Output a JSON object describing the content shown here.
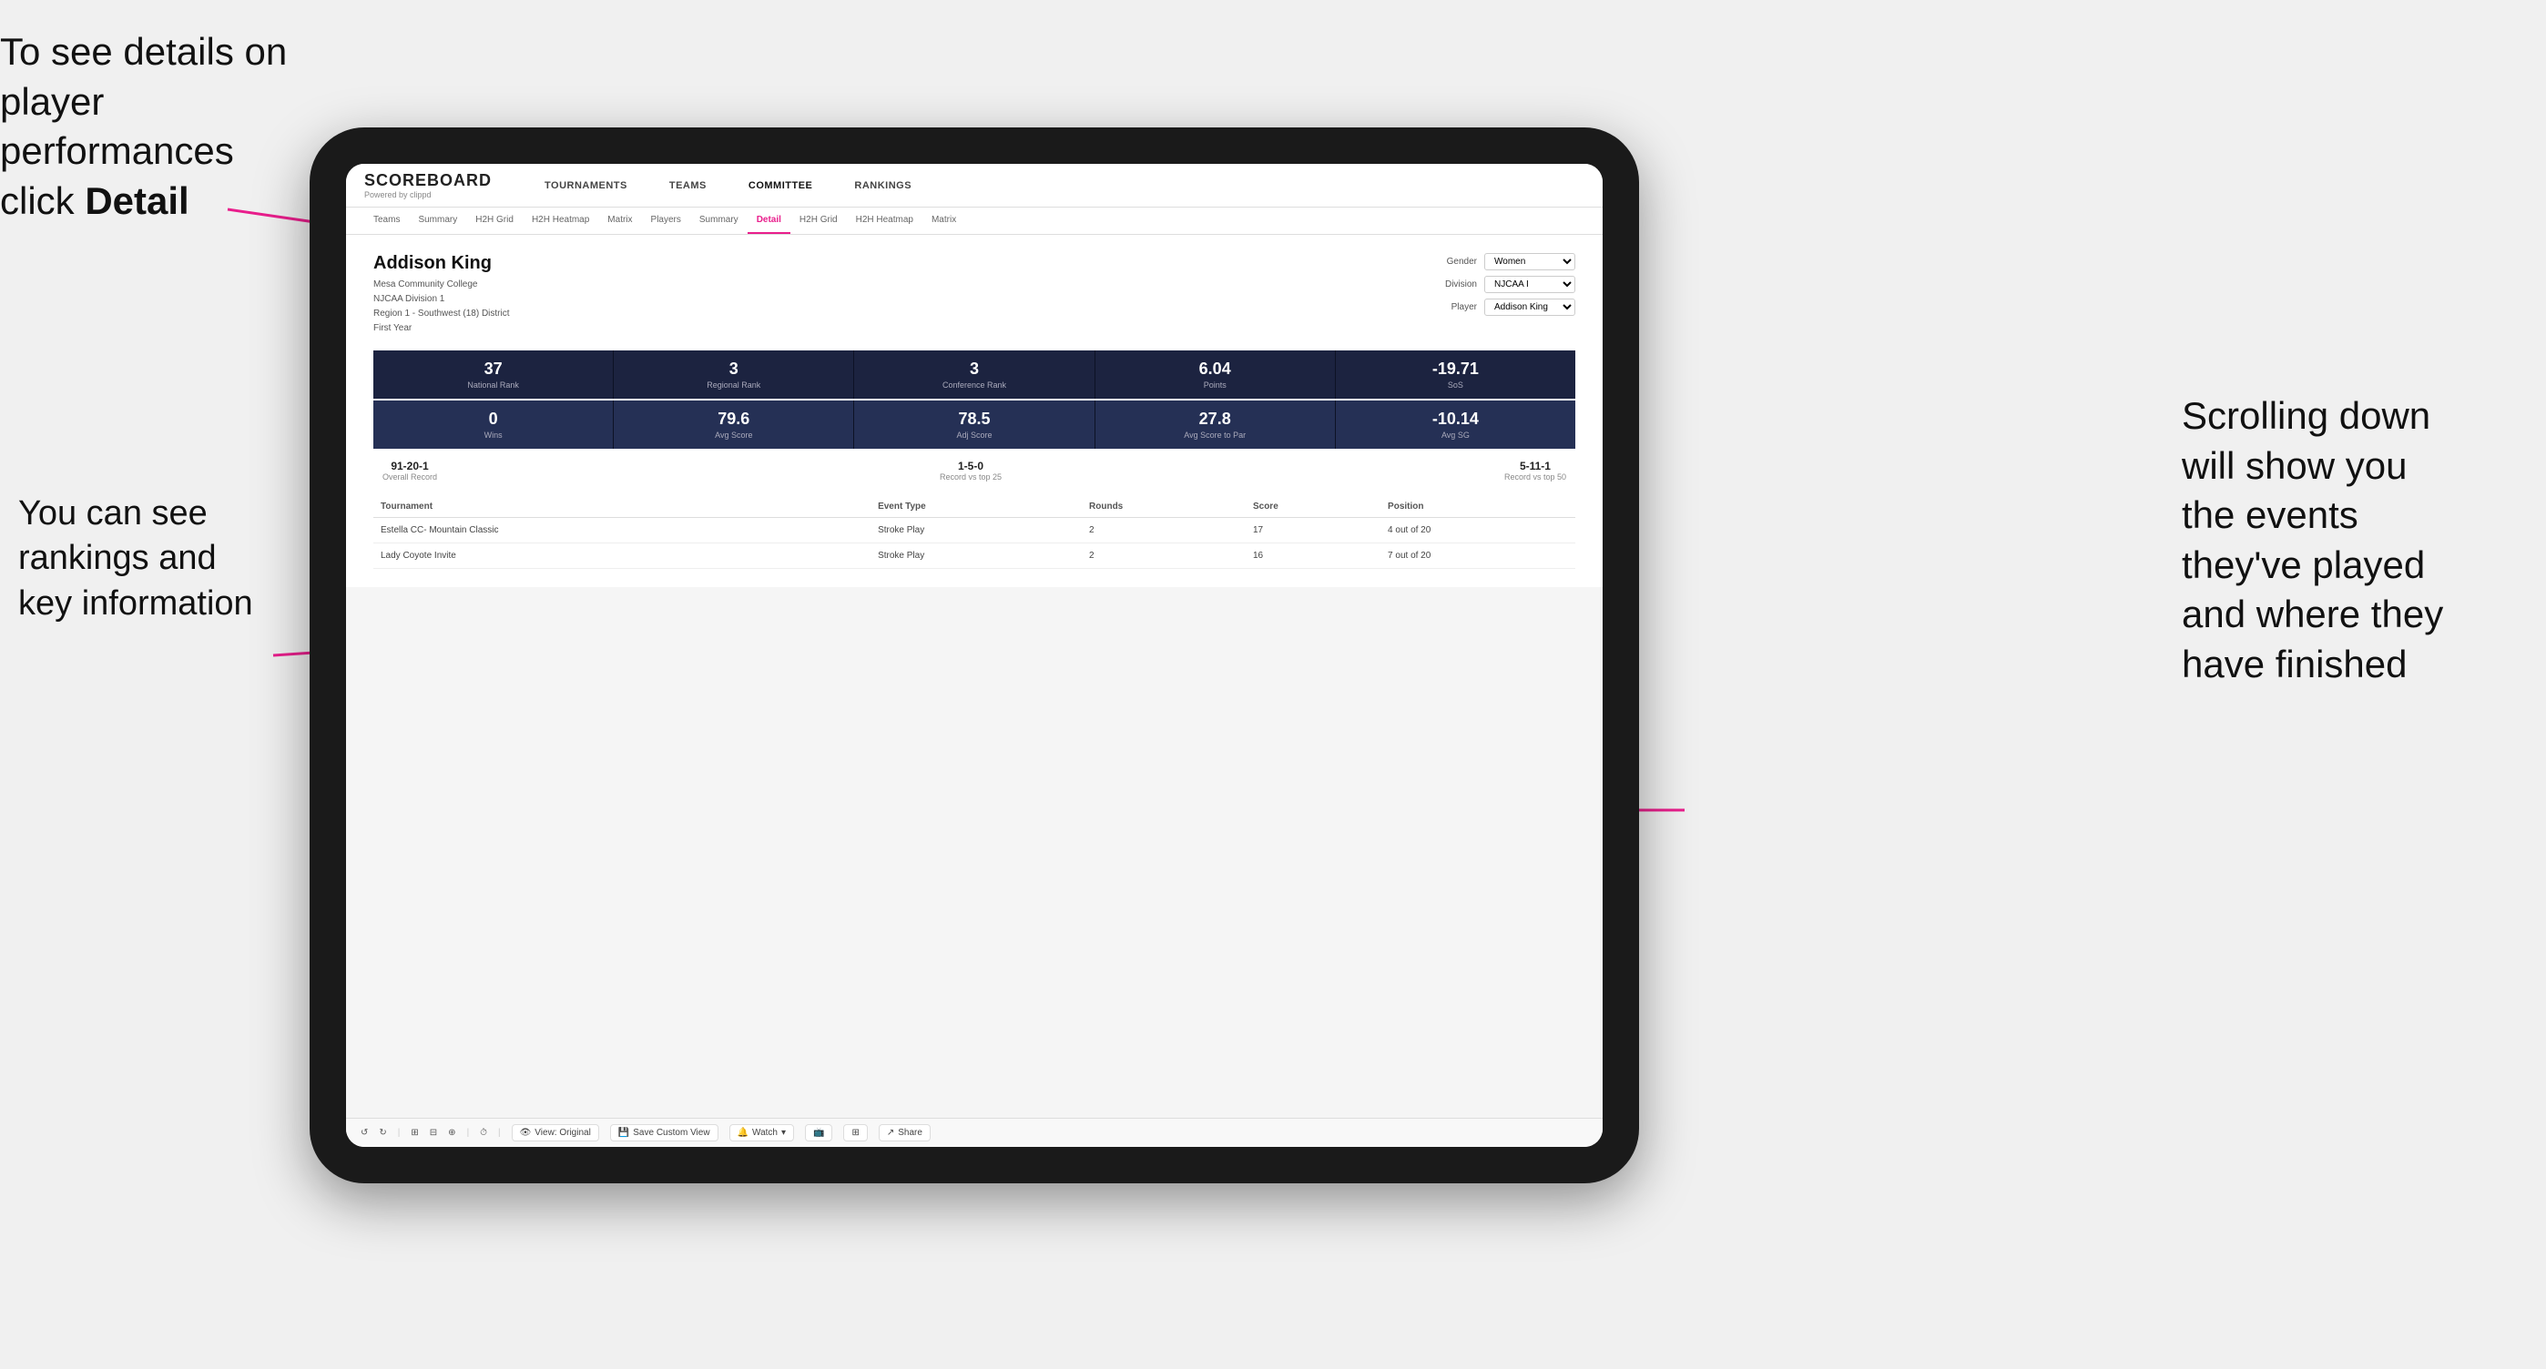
{
  "annotations": {
    "top_left_line1": "To see details on",
    "top_left_line2": "player performances",
    "top_left_line3": "click ",
    "top_left_bold": "Detail",
    "bottom_left_line1": "You can see",
    "bottom_left_line2": "rankings and",
    "bottom_left_line3": "key information",
    "right_line1": "Scrolling down",
    "right_line2": "will show you",
    "right_line3": "the events",
    "right_line4": "they've played",
    "right_line5": "and where they",
    "right_line6": "have finished"
  },
  "nav": {
    "logo": "SCOREBOARD",
    "logo_sub": "Powered by clippd",
    "items": [
      "TOURNAMENTS",
      "TEAMS",
      "COMMITTEE",
      "RANKINGS"
    ]
  },
  "sub_tabs": [
    "Teams",
    "Summary",
    "H2H Grid",
    "H2H Heatmap",
    "Matrix",
    "Players",
    "Summary",
    "Detail",
    "H2H Grid",
    "H2H Heatmap",
    "Matrix"
  ],
  "active_tab": "Detail",
  "player": {
    "name": "Addison King",
    "school": "Mesa Community College",
    "division": "NJCAA Division 1",
    "region": "Region 1 - Southwest (18) District",
    "year": "First Year",
    "gender_label": "Gender",
    "gender_value": "Women",
    "division_label": "Division",
    "division_value": "NJCAA I",
    "player_label": "Player",
    "player_value": "Addison King"
  },
  "stats_row1": [
    {
      "value": "37",
      "label": "National Rank"
    },
    {
      "value": "3",
      "label": "Regional Rank"
    },
    {
      "value": "3",
      "label": "Conference Rank"
    },
    {
      "value": "6.04",
      "label": "Points"
    },
    {
      "value": "-19.71",
      "label": "SoS"
    }
  ],
  "stats_row2": [
    {
      "value": "0",
      "label": "Wins"
    },
    {
      "value": "79.6",
      "label": "Avg Score"
    },
    {
      "value": "78.5",
      "label": "Adj Score"
    },
    {
      "value": "27.8",
      "label": "Avg Score to Par"
    },
    {
      "value": "-10.14",
      "label": "Avg SG"
    }
  ],
  "records": [
    {
      "value": "91-20-1",
      "label": "Overall Record"
    },
    {
      "value": "1-5-0",
      "label": "Record vs top 25"
    },
    {
      "value": "5-11-1",
      "label": "Record vs top 50"
    }
  ],
  "table_headers": [
    "Tournament",
    "",
    "Event Type",
    "Rounds",
    "Score",
    "Position"
  ],
  "tournaments": [
    {
      "name": "Estella CC- Mountain Classic",
      "event_type": "Stroke Play",
      "rounds": "2",
      "score": "17",
      "position": "4 out of 20"
    },
    {
      "name": "Lady Coyote Invite",
      "event_type": "Stroke Play",
      "rounds": "2",
      "score": "16",
      "position": "7 out of 20"
    }
  ],
  "toolbar": {
    "view_original": "View: Original",
    "save_custom": "Save Custom View",
    "watch": "Watch",
    "share": "Share"
  }
}
